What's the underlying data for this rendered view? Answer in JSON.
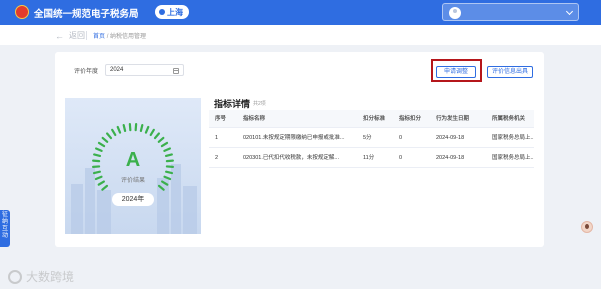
{
  "header": {
    "title": "全国统一规范电子税务局",
    "region": "上海",
    "brand_color": "#2f6de1"
  },
  "breadcrumb": {
    "back_label": "返回",
    "home": "首页",
    "separator": "/",
    "current": "纳税信用管理"
  },
  "filter": {
    "year_label": "评价年度",
    "year_value": "2024"
  },
  "actions": {
    "apply_adjust": "申请调整",
    "issue_result": "评价信息出具"
  },
  "grade": {
    "letter": "A",
    "subtitle": "评价结果",
    "year": "2024年",
    "accent_color": "#3bb04c"
  },
  "details": {
    "title": "指标详情",
    "count": "共2项",
    "columns": [
      "序号",
      "指标名称",
      "扣分标准",
      "指标扣分",
      "行为发生日期",
      "所属税务机关"
    ],
    "rows": [
      [
        "1",
        "020101.未按规定期限缴纳已申报或批准...",
        "5分",
        "0",
        "2024-09-18",
        "国家税务总局上..."
      ],
      [
        "2",
        "020301.已代扣代收税款，未按规定解...",
        "11分",
        "0",
        "2024-09-18",
        "国家税务总局上..."
      ]
    ]
  },
  "side_tab": [
    "征",
    "纳",
    "互",
    "动"
  ],
  "watermark": "大数跨境"
}
